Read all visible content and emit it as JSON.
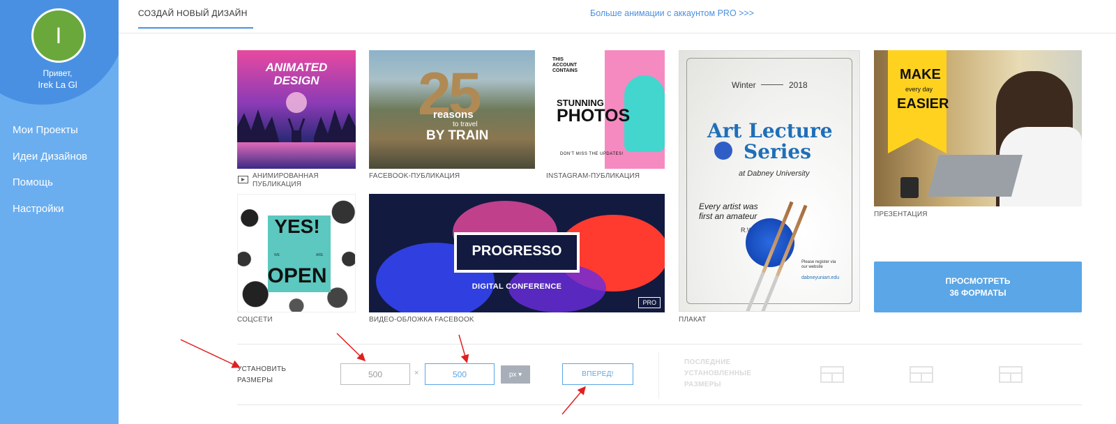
{
  "sidebar": {
    "avatar_initial": "I",
    "greeting": "Привет,",
    "user_name": "Irek La Gl",
    "items": [
      {
        "label": "Мои Проекты"
      },
      {
        "label": "Идеи Дизайнов"
      },
      {
        "label": "Помощь"
      },
      {
        "label": "Настройки"
      }
    ]
  },
  "topbar": {
    "active_tab": "СОЗДАЙ НОВЫЙ ДИЗАЙН",
    "pro_link": "Больше анимации с аккаунтом PRO >>>"
  },
  "templates": {
    "animated": {
      "caption_line1": "АНИМИРОВАННАЯ",
      "caption_line2": "ПУБЛИКАЦИЯ",
      "art_title_line1": "ANIMATED",
      "art_title_line2": "DESIGN"
    },
    "facebook": {
      "caption": "FACEBOOK-ПУБЛИКАЦИЯ",
      "art_number": "25",
      "art_line1": "reasons",
      "art_line2": "to travel",
      "art_line3": "BY TRAIN"
    },
    "instagram": {
      "caption": "INSTAGRAM-ПУБЛИКАЦИЯ",
      "art_small": "THIS ACCOUNT CONTAINS",
      "art_line1": "STUNNING",
      "art_line2": "PHOTOS",
      "art_footer": "DON'T MISS THE UPDATES!"
    },
    "poster": {
      "caption": "ПЛАКАТ",
      "art_season": "Winter",
      "art_year": "2018",
      "art_title_line1": "Art Lecture",
      "art_title_line2": "Series",
      "art_venue": "at Dabney University",
      "art_quote_line1": "Every artist was",
      "art_quote_line2": "first an amateur",
      "art_author": "R.W. Emerson",
      "art_register_line1": "Please register via",
      "art_register_line2": "our website",
      "art_site": "dabneyuniart.edu"
    },
    "presentation": {
      "caption": "ПРЕЗЕНТАЦИЯ",
      "art_line1": "MAKE",
      "art_line2": "every day",
      "art_line3": "EASIER"
    },
    "social": {
      "caption": "СОЦСЕТИ",
      "art_line1": "YES!",
      "art_we": "WE",
      "art_are": "ARE",
      "art_line2": "OPEN"
    },
    "video_cover": {
      "caption": "ВИДЕО-ОБЛОЖКА FACEBOOK",
      "art_title": "PROGRESSO",
      "art_subtitle": "DIGITAL CONFERENCE",
      "badge": "PRO"
    }
  },
  "view_formats": {
    "line1": "ПРОСМОТРЕТЬ",
    "line2": "36 ФОРМАТЫ"
  },
  "size_bar": {
    "label_line1": "УСТАНОВИТЬ",
    "label_line2": "РАЗМЕРЫ",
    "width_value": "500",
    "times": "×",
    "height_value": "500",
    "unit": "px ▾",
    "go_label": "ВПЕРЕД!",
    "recent_line1": "ПОСЛЕДНИЕ",
    "recent_line2": "УСТАНОВЛЕННЫЕ",
    "recent_line3": "РАЗМЕРЫ"
  },
  "colors": {
    "sidebar": "#6aaef0",
    "accent": "#4a90e2",
    "avatar": "#6aa83c",
    "annotation": "#e02020"
  }
}
